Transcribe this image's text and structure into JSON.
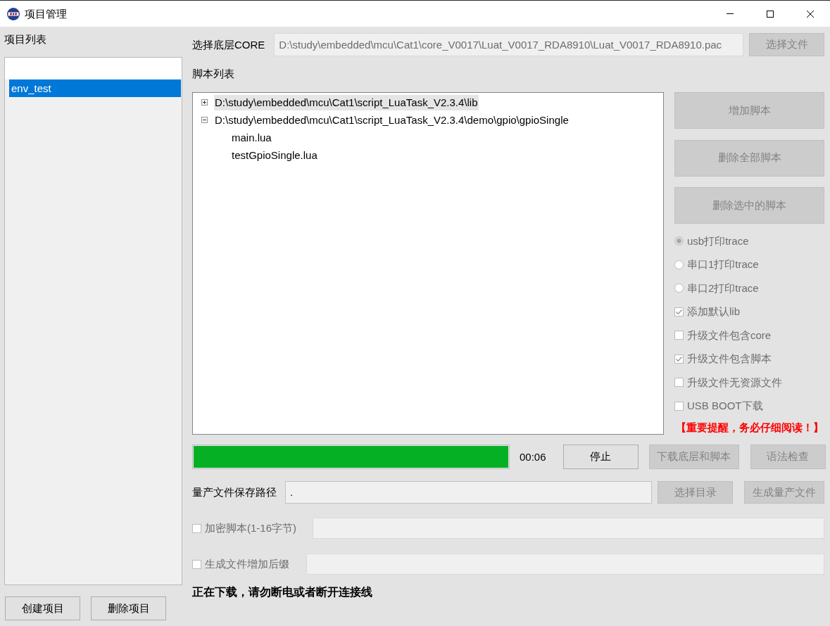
{
  "window": {
    "title": "项目管理"
  },
  "projects": {
    "label": "项目列表",
    "items": [
      {
        "name": "env_test",
        "selected": true
      }
    ],
    "buttons": [
      {
        "label": "创建项目",
        "disabled": false
      },
      {
        "label": "删除项目",
        "disabled": false
      }
    ]
  },
  "core": {
    "label": "选择底层CORE",
    "value": "D:\\study\\embedded\\mcu\\Cat1\\core_V0017\\Luat_V0017_RDA8910\\Luat_V0017_RDA8910.pac",
    "disabled": true,
    "button": {
      "label": "选择文件",
      "disabled": true
    }
  },
  "scripts": {
    "label": "脚本列表",
    "tree": [
      {
        "label": "D:\\study\\embedded\\mcu\\Cat1\\script_LuaTask_V2.3.4\\lib",
        "expanded": false,
        "selected": true
      },
      {
        "label": "D:\\study\\embedded\\mcu\\Cat1\\script_LuaTask_V2.3.4\\demo\\gpio\\gpioSingle",
        "expanded": true,
        "selected": false,
        "children": [
          {
            "label": "main.lua",
            "selected": false
          },
          {
            "label": "testGpioSingle.lua",
            "selected": false
          }
        ]
      }
    ],
    "buttons": [
      {
        "label": "增加脚本",
        "disabled": true
      },
      {
        "label": "删除全部脚本",
        "disabled": true
      },
      {
        "label": "删除选中的脚本",
        "disabled": true
      }
    ]
  },
  "options": [
    {
      "kind": "radio",
      "label": "usb打印trace",
      "selected": true,
      "disabled": true
    },
    {
      "kind": "radio",
      "label": "串口1打印trace",
      "selected": false,
      "disabled": true
    },
    {
      "kind": "radio",
      "label": "串口2打印trace",
      "selected": false,
      "disabled": true
    },
    {
      "kind": "checkbox",
      "label": "添加默认lib",
      "checked": true,
      "disabled": true
    },
    {
      "kind": "checkbox",
      "label": "升级文件包含core",
      "checked": false,
      "disabled": true
    },
    {
      "kind": "checkbox",
      "label": "升级文件包含脚本",
      "checked": true,
      "disabled": true
    },
    {
      "kind": "checkbox",
      "label": "升级文件无资源文件",
      "checked": false,
      "disabled": true
    },
    {
      "kind": "checkbox",
      "label": "USB BOOT下载",
      "checked": false,
      "disabled": true
    }
  ],
  "notice": "【重要提醒，务必仔细阅读！】",
  "progress": {
    "level": 1,
    "elapsed": "00:06"
  },
  "actions": [
    {
      "label": "停止",
      "disabled": false
    },
    {
      "label": "下载底层和脚本",
      "disabled": true
    },
    {
      "label": "语法检查",
      "disabled": true
    }
  ],
  "output": {
    "label": "量产文件保存路径",
    "value": ".",
    "disabled": false,
    "buttons": [
      {
        "label": "选择目录",
        "disabled": true
      },
      {
        "label": "生成量产文件",
        "disabled": true
      }
    ]
  },
  "encrypt": {
    "label": "加密脚本(1-16字节)",
    "checked": false,
    "disabled": true
  },
  "suffix": {
    "label": "生成文件增加后缀",
    "checked": false,
    "disabled": true
  },
  "status": "正在下载，请勿断电或者断开连接线"
}
